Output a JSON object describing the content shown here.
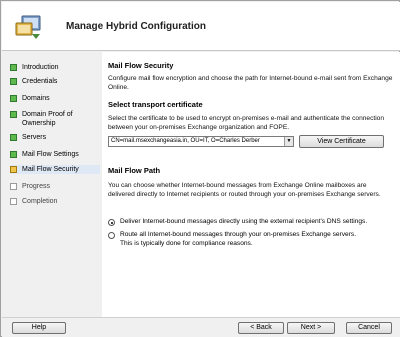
{
  "window": {
    "title": "Manage Hybrid Configuration"
  },
  "nav": {
    "items": [
      {
        "label": "Introduction",
        "state": "done"
      },
      {
        "label": "Credentials",
        "state": "done"
      },
      {
        "label": "Domains",
        "state": "done"
      },
      {
        "label": "Domain Proof of Ownership",
        "state": "done"
      },
      {
        "label": "Servers",
        "state": "done"
      },
      {
        "label": "Mail Flow Settings",
        "state": "done"
      },
      {
        "label": "Mail Flow Security",
        "state": "current"
      },
      {
        "label": "Progress",
        "state": "todo"
      },
      {
        "label": "Completion",
        "state": "todo"
      }
    ]
  },
  "main": {
    "heading": "Mail Flow Security",
    "intro": "Configure mail flow encryption and choose the path for Internet-bound e-mail sent from Exchange Online.",
    "cert_heading": "Select transport certificate",
    "cert_desc": "Select the certificate to be used to encrypt on-premises e-mail and authenticate the connection between your on-premises Exchange organization and FOPE.",
    "cert_value": "CN=mail.msexchangeasia.in, OU=IT, O=Charles Derber",
    "view_cert_label": "View Certificate",
    "path_heading": "Mail Flow Path",
    "path_desc": "You can choose whether Internet-bound messages from Exchange Online mailboxes are delivered directly to Internet recipients or routed through your on-premises Exchange servers.",
    "option_direct": "Deliver Internet-bound messages directly using the external recipient's DNS settings.",
    "option_route": "Route all Internet-bound messages through your on-premises Exchange servers. This is typically done for compliance reasons.",
    "selected_option": "direct"
  },
  "footer": {
    "help_label": "Help",
    "back_label": "< Back",
    "next_label": "Next >",
    "cancel_label": "Cancel"
  },
  "icons": {
    "wizard": "wizard-icon",
    "dropdown": "chevron-down-icon"
  },
  "colors": {
    "done": "#5fb94f",
    "current": "#f0c44a",
    "pending": "#ffffff"
  }
}
